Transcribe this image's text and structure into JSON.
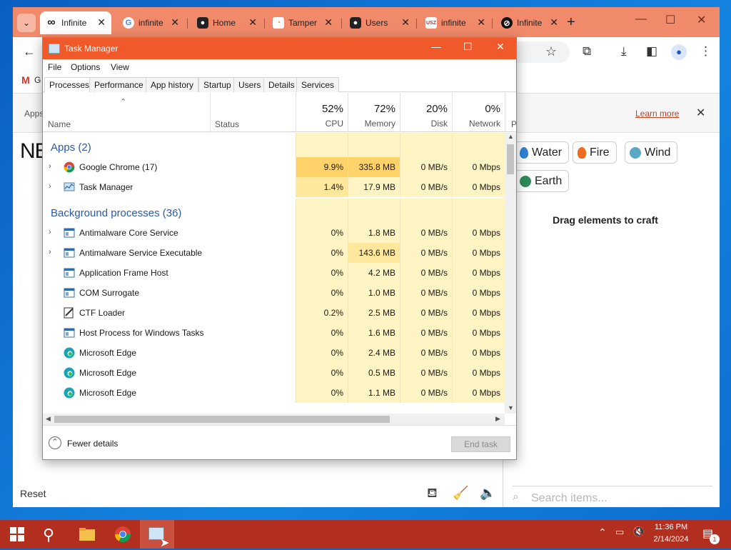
{
  "browser": {
    "tabs": [
      {
        "label": "Infinite",
        "icon": "infinity-icon",
        "active": true
      },
      {
        "label": "infinite",
        "icon": "google-icon"
      },
      {
        "label": "Home",
        "icon": "site-icon"
      },
      {
        "label": "Tamper",
        "icon": "tampermonkey-icon"
      },
      {
        "label": "Users",
        "icon": "site-icon"
      },
      {
        "label": "infinite",
        "icon": "usz-icon"
      },
      {
        "label": "Infinite",
        "icon": "infinite-icon"
      }
    ],
    "info_learn_more": "Learn more",
    "apps_label": "Apps",
    "gmail_label": "G",
    "page_title_fragment": "NE"
  },
  "game": {
    "elements": [
      {
        "label": "Water",
        "emoji_color": "#2b84d6"
      },
      {
        "label": "Fire",
        "emoji_color": "#f06a1e"
      },
      {
        "label": "Wind",
        "emoji_color": "#5aa8c8"
      },
      {
        "label": "Earth",
        "emoji_color": "#2e8b57"
      }
    ],
    "drag_hint": "Drag elements to craft",
    "reset_label": "Reset",
    "search_placeholder": "Search items..."
  },
  "task_manager": {
    "title": "Task Manager",
    "menu": [
      "File",
      "Options",
      "View"
    ],
    "tabs": [
      "Processes",
      "Performance",
      "App history",
      "Startup",
      "Users",
      "Details",
      "Services"
    ],
    "active_tab": "Processes",
    "columns": {
      "name": "Name",
      "status": "Status",
      "cpu": {
        "pct": "52%",
        "label": "CPU"
      },
      "memory": {
        "pct": "72%",
        "label": "Memory"
      },
      "disk": {
        "pct": "20%",
        "label": "Disk"
      },
      "network": {
        "pct": "0%",
        "label": "Network"
      },
      "power": "P"
    },
    "apps_group": "Apps (2)",
    "apps": [
      {
        "name": "Google Chrome (17)",
        "cpu": "9.9%",
        "memory": "335.8 MB",
        "disk": "0 MB/s",
        "network": "0 Mbps",
        "icon": "chrome-icon"
      },
      {
        "name": "Task Manager",
        "cpu": "1.4%",
        "memory": "17.9 MB",
        "disk": "0 MB/s",
        "network": "0 Mbps",
        "icon": "taskmanager-icon"
      }
    ],
    "bg_group": "Background processes (36)",
    "background": [
      {
        "name": "Antimalware Core Service",
        "cpu": "0%",
        "memory": "1.8 MB",
        "disk": "0 MB/s",
        "network": "0 Mbps",
        "icon": "process-icon",
        "expand": true
      },
      {
        "name": "Antimalware Service Executable",
        "cpu": "0%",
        "memory": "143.6 MB",
        "disk": "0 MB/s",
        "network": "0 Mbps",
        "icon": "process-icon",
        "expand": true
      },
      {
        "name": "Application Frame Host",
        "cpu": "0%",
        "memory": "4.2 MB",
        "disk": "0 MB/s",
        "network": "0 Mbps",
        "icon": "process-icon"
      },
      {
        "name": "COM Surrogate",
        "cpu": "0%",
        "memory": "1.0 MB",
        "disk": "0 MB/s",
        "network": "0 Mbps",
        "icon": "process-icon"
      },
      {
        "name": "CTF Loader",
        "cpu": "0.2%",
        "memory": "2.5 MB",
        "disk": "0 MB/s",
        "network": "0 Mbps",
        "icon": "ctf-icon"
      },
      {
        "name": "Host Process for Windows Tasks",
        "cpu": "0%",
        "memory": "1.6 MB",
        "disk": "0 MB/s",
        "network": "0 Mbps",
        "icon": "process-icon"
      },
      {
        "name": "Microsoft Edge",
        "cpu": "0%",
        "memory": "2.4 MB",
        "disk": "0 MB/s",
        "network": "0 Mbps",
        "icon": "edge-icon"
      },
      {
        "name": "Microsoft Edge",
        "cpu": "0%",
        "memory": "0.5 MB",
        "disk": "0 MB/s",
        "network": "0 Mbps",
        "icon": "edge-icon"
      },
      {
        "name": "Microsoft Edge",
        "cpu": "0%",
        "memory": "1.1 MB",
        "disk": "0 MB/s",
        "network": "0 Mbps",
        "icon": "edge-icon"
      }
    ],
    "fewer_details": "Fewer details",
    "end_task": "End task"
  },
  "taskbar": {
    "time": "11:36 PM",
    "date": "2/14/2024",
    "notification_count": "1"
  },
  "colors": {
    "chrome_tabstrip": "#f08a6a",
    "tm_title": "#f05a2a",
    "taskbar": "#b22f20",
    "heat_low": "#fff4c4",
    "heat_mid": "#ffe79b",
    "heat_high": "#ffd26a"
  }
}
